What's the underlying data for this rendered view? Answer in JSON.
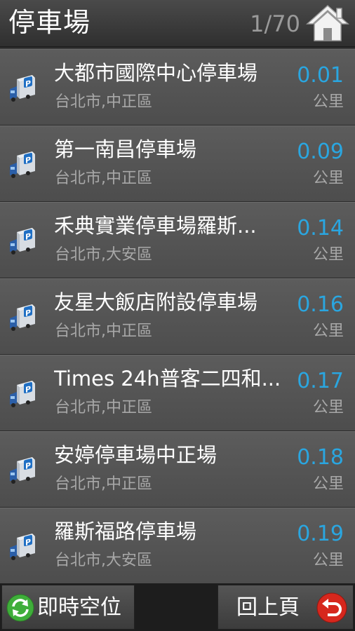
{
  "header": {
    "title": "停車場",
    "counter": "1/70",
    "home_icon": "home-icon"
  },
  "colors": {
    "distance": "#2aa6e0",
    "text": "#ffffff",
    "subtext": "#a8a8a8"
  },
  "list": {
    "items": [
      {
        "name": "大都市國際中心停車場",
        "address": "台北市,中正區",
        "distance": "0.01",
        "unit": "公里"
      },
      {
        "name": "第一南昌停車場",
        "address": "台北市,中正區",
        "distance": "0.09",
        "unit": "公里"
      },
      {
        "name": "禾典實業停車場羅斯...",
        "address": "台北市,大安區",
        "distance": "0.14",
        "unit": "公里"
      },
      {
        "name": "友星大飯店附設停車場",
        "address": "台北市,中正區",
        "distance": "0.16",
        "unit": "公里"
      },
      {
        "name": "Times 24h普客二四和...",
        "address": "台北市,中正區",
        "distance": "0.17",
        "unit": "公里"
      },
      {
        "name": "安婷停車場中正場",
        "address": "台北市,中正區",
        "distance": "0.18",
        "unit": "公里"
      },
      {
        "name": "羅斯福路停車場",
        "address": "台北市,大安區",
        "distance": "0.19",
        "unit": "公里"
      }
    ]
  },
  "bottombar": {
    "realtime_label": "即時空位",
    "back_label": "回上頁"
  }
}
